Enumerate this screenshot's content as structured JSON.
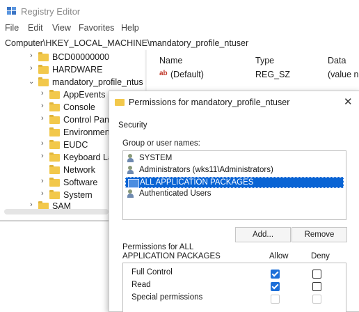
{
  "regedit": {
    "title": "Registry Editor",
    "menu": [
      "File",
      "Edit",
      "View",
      "Favorites",
      "Help"
    ],
    "address": "Computer\\HKEY_LOCAL_MACHINE\\mandatory_profile_ntuser",
    "tree": [
      {
        "label": "BCD00000000",
        "expanded": false
      },
      {
        "label": "HARDWARE",
        "expanded": false
      },
      {
        "label": "mandatory_profile_ntus",
        "expanded": true
      },
      {
        "label": "AppEvents",
        "expanded": false
      },
      {
        "label": "Console",
        "expanded": false
      },
      {
        "label": "Control Pan",
        "expanded": false
      },
      {
        "label": "Environmen",
        "expanded": false
      },
      {
        "label": "EUDC",
        "expanded": false
      },
      {
        "label": "Keyboard La",
        "expanded": false
      },
      {
        "label": "Network",
        "expanded": false
      },
      {
        "label": "Software",
        "expanded": false
      },
      {
        "label": "System",
        "expanded": false
      },
      {
        "label": "SAM",
        "expanded": false
      }
    ],
    "columns": {
      "name": "Name",
      "type": "Type",
      "data": "Data"
    },
    "values": [
      {
        "name": "(Default)",
        "type": "REG_SZ",
        "data": "(value no"
      }
    ]
  },
  "dialog": {
    "title": "Permissions for mandatory_profile_ntuser",
    "tab": "Security",
    "group_label": "Group or user names:",
    "users": [
      {
        "label": "SYSTEM",
        "selected": false
      },
      {
        "label": "Administrators (wks11\\Administrators)",
        "selected": false
      },
      {
        "label": "ALL APPLICATION PACKAGES",
        "selected": true
      },
      {
        "label": "Authenticated Users",
        "selected": false
      }
    ],
    "add_label": "Add...",
    "remove_label": "Remove",
    "perm_label_line1": "Permissions for ALL",
    "perm_label_line2": "APPLICATION PACKAGES",
    "allow_header": "Allow",
    "deny_header": "Deny",
    "permissions": [
      {
        "label": "Full Control",
        "allow": true,
        "deny": false
      },
      {
        "label": "Read",
        "allow": true,
        "deny": false
      },
      {
        "label": "Special permissions",
        "allow": false,
        "deny": false,
        "disabled": true
      }
    ]
  }
}
